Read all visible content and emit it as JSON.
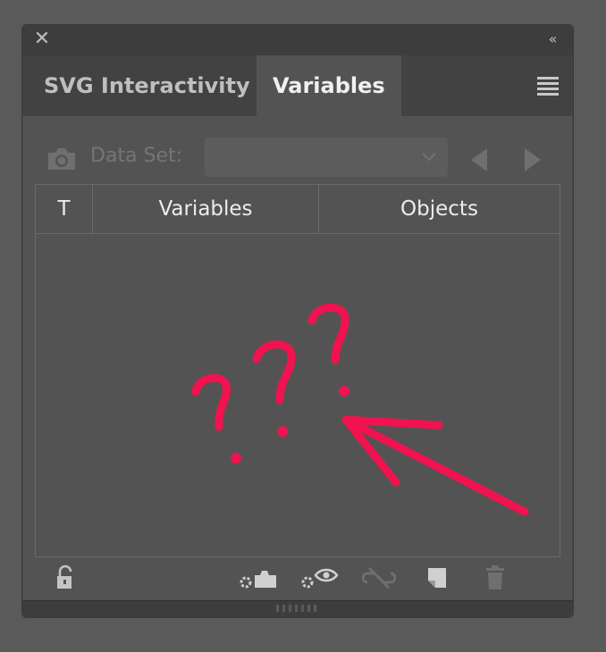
{
  "panel": {
    "tabs": [
      {
        "label": "SVG Interactivity",
        "active": false
      },
      {
        "label": "Variables",
        "active": true
      }
    ],
    "icons": {
      "close": "close-icon",
      "collapse": "double-chevron-left-icon",
      "menu": "hamburger-menu-icon"
    }
  },
  "dataset": {
    "label": "Data Set:",
    "value": "",
    "enabled": false
  },
  "table": {
    "columns": [
      "T",
      "Variables",
      "Objects"
    ],
    "rows": []
  },
  "annotation": {
    "marks": "???",
    "color": "#f0134f"
  },
  "toolbar": {
    "buttons": [
      {
        "name": "lock-variables",
        "icon": "lock-icon",
        "enabled": true
      },
      {
        "name": "capture-data-set",
        "icon": "capture-dataset-icon",
        "enabled": true
      },
      {
        "name": "make-visibility-dynamic",
        "icon": "visibility-dynamic-icon",
        "enabled": true
      },
      {
        "name": "unbind-variable",
        "icon": "unbind-icon",
        "enabled": false
      },
      {
        "name": "new-variable",
        "icon": "new-variable-icon",
        "enabled": true
      },
      {
        "name": "delete-variable",
        "icon": "trash-icon",
        "enabled": false
      }
    ]
  },
  "colors": {
    "panel_bg": "#535353",
    "titlebar_bg": "#3d3d3d",
    "text_active": "#f0f0f0",
    "text_inactive": "#bfbfbf",
    "text_disabled": "#757575"
  }
}
